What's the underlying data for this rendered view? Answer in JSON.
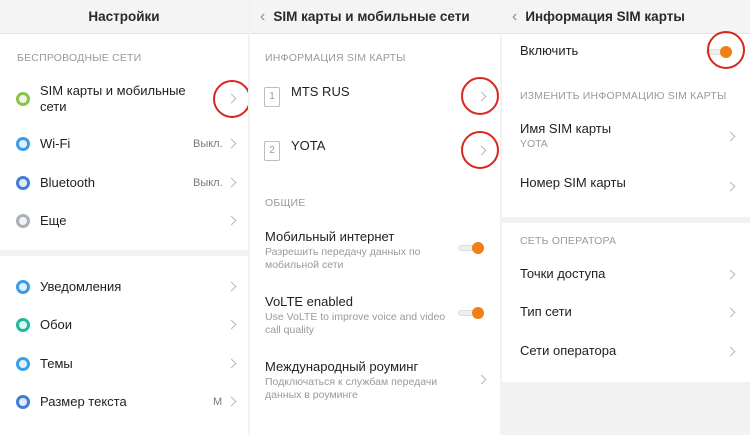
{
  "panel1": {
    "title": "Настройки",
    "section_wireless": "БЕСПРОВОДНЫЕ СЕТИ",
    "items": [
      {
        "label": "SIM карты и мобильные сети",
        "value": ""
      },
      {
        "label": "Wi-Fi",
        "value": "Выкл."
      },
      {
        "label": "Bluetooth",
        "value": "Выкл."
      },
      {
        "label": "Еще",
        "value": ""
      },
      {
        "label": "Уведомления",
        "value": ""
      },
      {
        "label": "Обои",
        "value": ""
      },
      {
        "label": "Темы",
        "value": ""
      },
      {
        "label": "Размер текста",
        "value": "М"
      }
    ]
  },
  "panel2": {
    "title": "SIM карты и мобильные сети",
    "section_sim": "ИНФОРМАЦИЯ SIM КАРТЫ",
    "sims": [
      {
        "slot": "1",
        "name": "MTS RUS"
      },
      {
        "slot": "2",
        "name": "YOTA"
      }
    ],
    "section_general": "ОБЩИЕ",
    "settings": [
      {
        "label": "Мобильный интернет",
        "desc": "Разрешить передачу данных по мобильной сети",
        "enabled": true
      },
      {
        "label": "VoLTE enabled",
        "desc": "Use VoLTE to improve voice and video call quality",
        "enabled": true
      },
      {
        "label": "Международный роуминг",
        "desc": "Подключаться к службам передачи данных в роуминге"
      }
    ]
  },
  "panel3": {
    "title": "Информация SIM карты",
    "enable_label": "Включить",
    "enable_on": true,
    "section_edit": "ИЗМЕНИТЬ ИНФОРМАЦИЮ SIM КАРТЫ",
    "sim_name_label": "Имя SIM карты",
    "sim_name_value": "YOTA",
    "sim_number_label": "Номер SIM карты",
    "section_operator": "СЕТЬ ОПЕРАТОРА",
    "operator_items": [
      "Точки доступа",
      "Тип сети",
      "Сети оператора"
    ]
  },
  "colors": {
    "accent": "#f07f16",
    "highlight_circle": "#d8271d"
  },
  "icons": [
    "sim-icon",
    "wifi-icon",
    "bluetooth-icon",
    "more-icon",
    "notifications-icon",
    "wallpaper-icon",
    "themes-icon",
    "text-size-icon",
    "back-arrow-icon",
    "chevron-right-icon"
  ]
}
